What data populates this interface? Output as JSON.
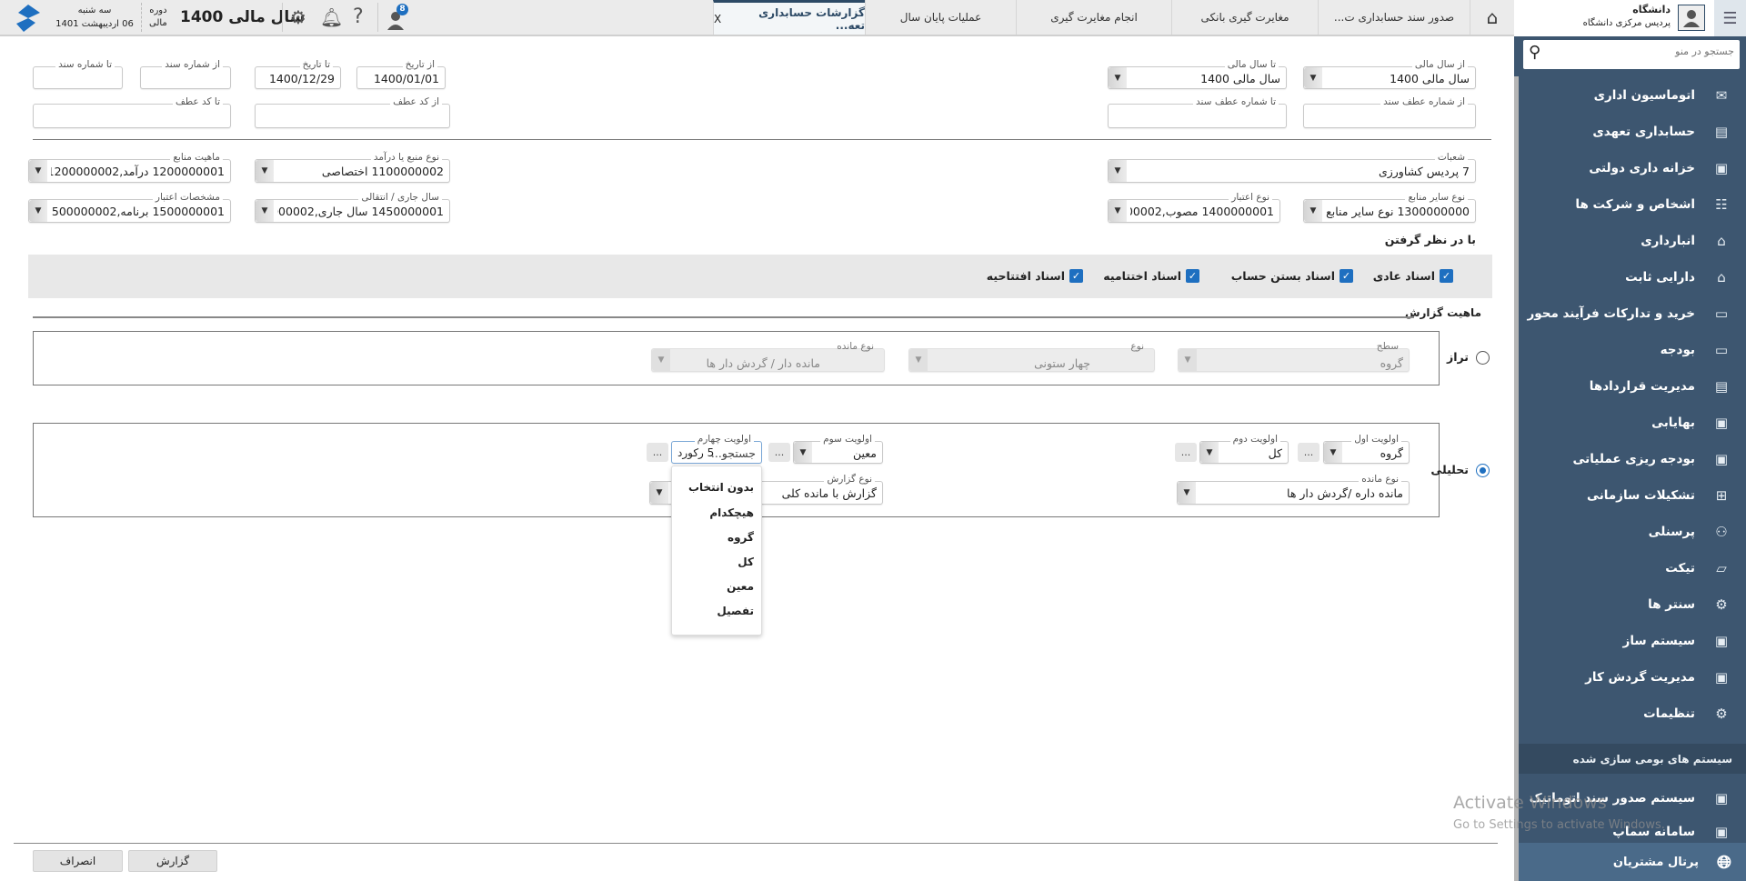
{
  "header": {
    "date_weekday": "سه شنبه",
    "date": "06 اردیبهشت 1401",
    "period_label_1": "دوره",
    "period_label_2": "مالی",
    "fiscal_year": "سال مالی 1400",
    "notification_count": "8",
    "tabs": [
      {
        "label": "گزارشات حسابداری تعه...",
        "active": true,
        "close": "X"
      },
      {
        "label": "عملیات پایان سال"
      },
      {
        "label": "انجام مغایرت گیری"
      },
      {
        "label": "مغایرت گیری بانکی"
      },
      {
        "label": "صدور سند حسابداری ت..."
      }
    ]
  },
  "filters": {
    "from_fy": {
      "label": "از سال مالی",
      "value": "سال مالی 1400"
    },
    "to_fy": {
      "label": "تا سال مالی",
      "value": "سال مالی 1400"
    },
    "from_date": {
      "label": "از تاریخ",
      "value": "1400/01/01"
    },
    "to_date": {
      "label": "تا تاریخ",
      "value": "1400/12/29"
    },
    "from_doc": {
      "label": "از شماره سند",
      "value": ""
    },
    "to_doc": {
      "label": "تا شماره سند",
      "value": ""
    },
    "from_ref_doc": {
      "label": "از شماره عطف سند",
      "value": ""
    },
    "to_ref_doc": {
      "label": "تا شماره عطف سند",
      "value": ""
    },
    "from_ref_code": {
      "label": "از کد عطف",
      "value": ""
    },
    "to_ref_code": {
      "label": "تا کد عطف",
      "value": ""
    },
    "branches": {
      "label": "شعبات",
      "value": "7 پردیس کشاورزی"
    },
    "source_type": {
      "label": "نوع منبع یا درآمد",
      "value": "1100000002 اختصاصی"
    },
    "source_nature": {
      "label": "ماهیت منابع",
      "value": "1200000001 درآمد,1200000002 واگذار..."
    },
    "other_source_type": {
      "label": "نوع سایر منابع",
      "value": "1300000000 نوع سایر منابع ندارد..."
    },
    "credit_type": {
      "label": "نوع اعتبار",
      "value": "1400000001 مصوب,00000002..."
    },
    "current_year": {
      "label": "سال جاری / انتقالی",
      "value": "1450000001 سال جاری,450000002..."
    },
    "credit_spec": {
      "label": "مشخصات اعتبار",
      "value": "1500000001 برنامه,1500000002 طرح..."
    }
  },
  "consider": {
    "title": "با در نظر گرفتن",
    "items": [
      {
        "label": "اسناد عادی",
        "checked": true
      },
      {
        "label": "اسناد بستن حساب",
        "checked": true
      },
      {
        "label": "اسناد اختتامیه",
        "checked": true
      },
      {
        "label": "اسناد افتتاحیه",
        "checked": true
      }
    ]
  },
  "report_nature": {
    "title": "ماهیت گزارش",
    "balance": {
      "label": "تراز",
      "selected": false,
      "level": {
        "label": "سطح",
        "value": "گروه"
      },
      "type": {
        "label": "نوع",
        "value": "چهار ستونی"
      },
      "remain_type": {
        "label": "نوع مانده",
        "value": "مانده دار / گردش دار ها"
      }
    },
    "analytic": {
      "label": "تحلیلی",
      "selected": true,
      "p1": {
        "label": "اولویت اول",
        "value": "گروه"
      },
      "p2": {
        "label": "اولویت دوم",
        "value": "کل"
      },
      "p3": {
        "label": "اولویت سوم",
        "value": "معین"
      },
      "p4": {
        "label": "اولویت چهارم",
        "placeholder": "جستجو...",
        "count": "5 رکورد"
      },
      "remain_type": {
        "label": "نوع مانده",
        "value": "مانده داره /گردش دار ها"
      },
      "report_type": {
        "label": "نوع گزارش",
        "value": "گزارش با مانده کلی"
      },
      "dots": "...",
      "dropdown": [
        "بدون انتخاب",
        "هیچکدام",
        "گروه",
        "کل",
        "معین",
        "تفصیل"
      ]
    }
  },
  "buttons": {
    "report": "گزارش",
    "cancel": "انصراف"
  },
  "sidebar": {
    "org": "دانشگاه",
    "campus": "پردیس مرکزی دانشگاه",
    "search_placeholder": "جستجو در منو",
    "items": [
      {
        "label": "اتوماسیون اداری",
        "icon": "mail-icon"
      },
      {
        "label": "حسابداری تعهدی",
        "icon": "ledger-icon"
      },
      {
        "label": "خزانه داری دولتی",
        "icon": "safe-icon"
      },
      {
        "label": "اشخاص و شرکت ها",
        "icon": "people-list-icon"
      },
      {
        "label": "انبارداری",
        "icon": "warehouse-icon"
      },
      {
        "label": "دارایی ثابت",
        "icon": "house-icon"
      },
      {
        "label": "خرید و تدارکات فرآیند محور",
        "icon": "archive-icon"
      },
      {
        "label": "بودجه",
        "icon": "wallet-icon"
      },
      {
        "label": "مدیریت قراردادها",
        "icon": "contract-icon"
      },
      {
        "label": "بهایابی",
        "icon": "monitor-code-icon"
      },
      {
        "label": "بودجه ریزی عملیاتی",
        "icon": "monitor-code-icon"
      },
      {
        "label": "تشکیلات سازمانی",
        "icon": "org-chart-icon"
      },
      {
        "label": "پرسنلی",
        "icon": "group-icon"
      },
      {
        "label": "تیکت",
        "icon": "ticket-icon"
      },
      {
        "label": "سنتر ها",
        "icon": "gear-calendar-icon"
      },
      {
        "label": "سیستم ساز",
        "icon": "monitor-code-icon"
      },
      {
        "label": "مدیریت گردش کار",
        "icon": "monitor-code-icon"
      },
      {
        "label": "تنظیمات",
        "icon": "gear-icon"
      }
    ],
    "section": "سیستم های بومی سازی شده",
    "section_items": [
      {
        "label": "سیستم صدور سند اتوماتیک",
        "icon": "monitor-code-icon"
      },
      {
        "label": "سامانه سماپ",
        "icon": "monitor-code-icon"
      }
    ],
    "portal": "پرتال مشتریان"
  },
  "watermark": {
    "line1": "Activate Windows",
    "line2": "Go to Settings to activate Windows."
  },
  "colors": {
    "sidebar": "#3d5670",
    "accent": "#1e6fc0",
    "header": "#ebebeb"
  }
}
